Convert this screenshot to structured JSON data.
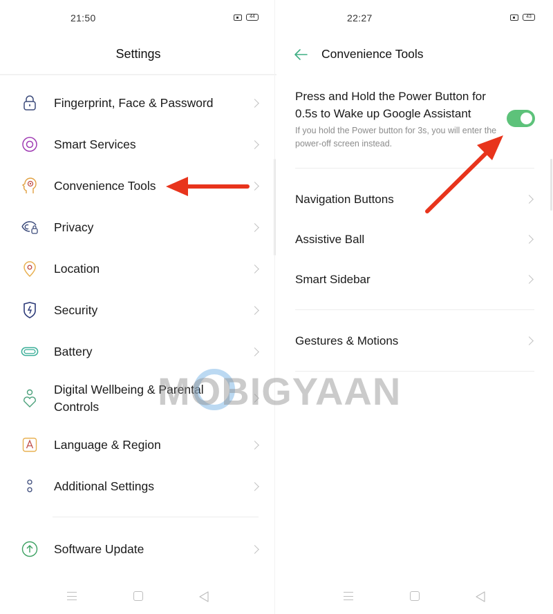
{
  "left_screen": {
    "status": {
      "time": "21:50",
      "battery": "44"
    },
    "title": "Settings",
    "items": [
      {
        "label": "Fingerprint, Face & Password",
        "icon": "lock-icon"
      },
      {
        "label": "Smart Services",
        "icon": "target-circle-icon"
      },
      {
        "label": "Convenience Tools",
        "icon": "head-gear-icon"
      },
      {
        "label": "Privacy",
        "icon": "eye-lock-icon"
      },
      {
        "label": "Location",
        "icon": "location-pin-icon"
      },
      {
        "label": "Security",
        "icon": "shield-bolt-icon"
      },
      {
        "label": "Battery",
        "icon": "battery-icon"
      },
      {
        "label": "Digital Wellbeing & Parental Controls",
        "label_line1": "Digital Wellbeing & Parental",
        "label_line2": "Controls",
        "icon": "person-heart-icon"
      },
      {
        "label": "Language & Region",
        "icon": "letter-a-icon"
      },
      {
        "label": "Additional Settings",
        "icon": "two-dots-icon"
      },
      {
        "label": "Software Update",
        "icon": "arrow-up-circle-icon"
      }
    ]
  },
  "right_screen": {
    "status": {
      "time": "22:27",
      "battery": "43"
    },
    "title": "Convenience Tools",
    "toggle_setting": {
      "title": "Press and Hold the Power Button for 0.5s to Wake up Google Assistant",
      "subtitle": "If you hold the Power button for 3s, you will enter the power-off screen instead.",
      "enabled": true
    },
    "items": [
      {
        "label": "Navigation Buttons"
      },
      {
        "label": "Assistive Ball"
      },
      {
        "label": "Smart Sidebar"
      },
      {
        "label": "Gestures & Motions"
      }
    ]
  },
  "watermark": "MOBIGYAAN",
  "colors": {
    "accent_green": "#5dc27a",
    "annotation_red": "#e8341c",
    "back_arrow": "#3fae84"
  }
}
